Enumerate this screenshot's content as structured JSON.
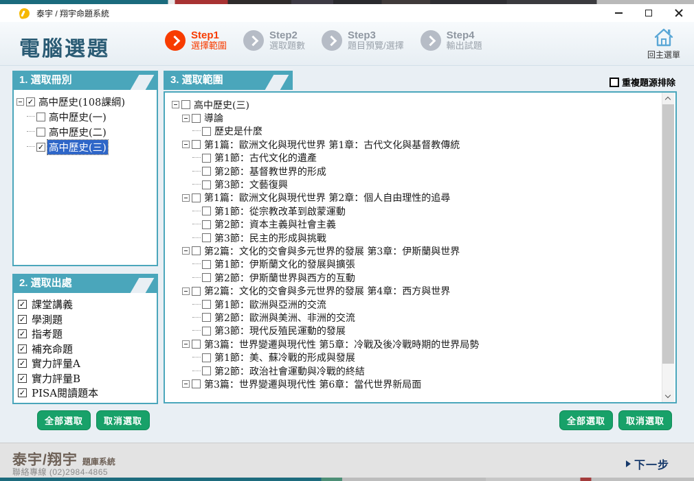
{
  "theme": {
    "panel_teal": "#4aa6bb",
    "dark_teal": "#1a6b7d",
    "active_step_orange": "#f83c00",
    "button_green": "#18a169",
    "selection_blue": "#2e66c8",
    "next_navy": "#16396b"
  },
  "window": {
    "title": "泰宇 / 翔宇命題系統"
  },
  "header": {
    "title": "電腦選題",
    "home_label": "回主選單",
    "steps": [
      {
        "name": "Step1",
        "label": "選擇範圍",
        "active": true
      },
      {
        "name": "Step2",
        "label": "選取題數",
        "active": false
      },
      {
        "name": "Step3",
        "label": "題目預覽/選擇",
        "active": false
      },
      {
        "name": "Step4",
        "label": "輸出試題",
        "active": false
      }
    ]
  },
  "panels": {
    "books": {
      "title": "1. 選取冊別",
      "tree": [
        {
          "level": 0,
          "expand": true,
          "checked": true,
          "selected": false,
          "label": "高中歷史(108課綱)"
        },
        {
          "level": 1,
          "expand": false,
          "checked": false,
          "selected": false,
          "label": "高中歷史(一)"
        },
        {
          "level": 1,
          "expand": false,
          "checked": false,
          "selected": false,
          "label": "高中歷史(二)"
        },
        {
          "level": 1,
          "expand": false,
          "checked": true,
          "selected": true,
          "label": "高中歷史(三)"
        }
      ]
    },
    "sources": {
      "title": "2. 選取出處",
      "items": [
        {
          "label": "課堂講義",
          "checked": true
        },
        {
          "label": "學測題",
          "checked": true
        },
        {
          "label": "指考題",
          "checked": true
        },
        {
          "label": "補充命題",
          "checked": true
        },
        {
          "label": "實力評量A",
          "checked": true
        },
        {
          "label": "實力評量B",
          "checked": true
        },
        {
          "label": "PISA閱讀題本",
          "checked": true
        }
      ]
    },
    "scope": {
      "title": "3. 選取範圍",
      "dedupe_label": "重複題源排除",
      "dedupe_checked": false,
      "tree": [
        {
          "level": 0,
          "expand": true,
          "checked": false,
          "label": "高中歷史(三)"
        },
        {
          "level": 1,
          "expand": true,
          "checked": false,
          "label": "導論"
        },
        {
          "level": 2,
          "expand": false,
          "checked": false,
          "label": "歷史是什麼"
        },
        {
          "level": 1,
          "expand": true,
          "checked": false,
          "label": "第1篇：歐洲文化與現代世界 第1章：古代文化與基督教傳統"
        },
        {
          "level": 2,
          "expand": false,
          "checked": false,
          "label": "第1節：古代文化的遺產"
        },
        {
          "level": 2,
          "expand": false,
          "checked": false,
          "label": "第2節：基督教世界的形成"
        },
        {
          "level": 2,
          "expand": false,
          "checked": false,
          "label": "第3節：文藝復興"
        },
        {
          "level": 1,
          "expand": true,
          "checked": false,
          "label": "第1篇：歐洲文化與現代世界 第2章：個人自由理性的追尋"
        },
        {
          "level": 2,
          "expand": false,
          "checked": false,
          "label": "第1節：從宗教改革到啟蒙運動"
        },
        {
          "level": 2,
          "expand": false,
          "checked": false,
          "label": "第2節：資本主義與社會主義"
        },
        {
          "level": 2,
          "expand": false,
          "checked": false,
          "label": "第3節：民主的形成與挑戰"
        },
        {
          "level": 1,
          "expand": true,
          "checked": false,
          "label": "第2篇：文化的交會與多元世界的發展 第3章：伊斯蘭與世界"
        },
        {
          "level": 2,
          "expand": false,
          "checked": false,
          "label": "第1節：伊斯蘭文化的發展與擴張"
        },
        {
          "level": 2,
          "expand": false,
          "checked": false,
          "label": "第2節：伊斯蘭世界與西方的互動"
        },
        {
          "level": 1,
          "expand": true,
          "checked": false,
          "label": "第2篇：文化的交會與多元世界的發展 第4章：西方與世界"
        },
        {
          "level": 2,
          "expand": false,
          "checked": false,
          "label": "第1節：歐洲與亞洲的交流"
        },
        {
          "level": 2,
          "expand": false,
          "checked": false,
          "label": "第2節：歐洲與美洲、非洲的交流"
        },
        {
          "level": 2,
          "expand": false,
          "checked": false,
          "label": "第3節：現代反殖民運動的發展"
        },
        {
          "level": 1,
          "expand": true,
          "checked": false,
          "label": "第3篇：世界變遷與現代性 第5章：冷戰及後冷戰時期的世界局勢"
        },
        {
          "level": 2,
          "expand": false,
          "checked": false,
          "label": "第1節：美、蘇冷戰的形成與發展"
        },
        {
          "level": 2,
          "expand": false,
          "checked": false,
          "label": "第2節：政治社會運動與冷戰的終結"
        },
        {
          "level": 1,
          "expand": true,
          "checked": false,
          "label": "第3篇：世界變遷與現代性 第6章：當代世界新局面"
        }
      ]
    }
  },
  "actions": {
    "select_all": "全部選取",
    "deselect_all": "取消選取"
  },
  "footer": {
    "brand": "泰宇/翔宇",
    "brand_suffix": "題庫系統",
    "hotline": "聯絡專線 (02)2984-4865",
    "next": "下一步"
  }
}
